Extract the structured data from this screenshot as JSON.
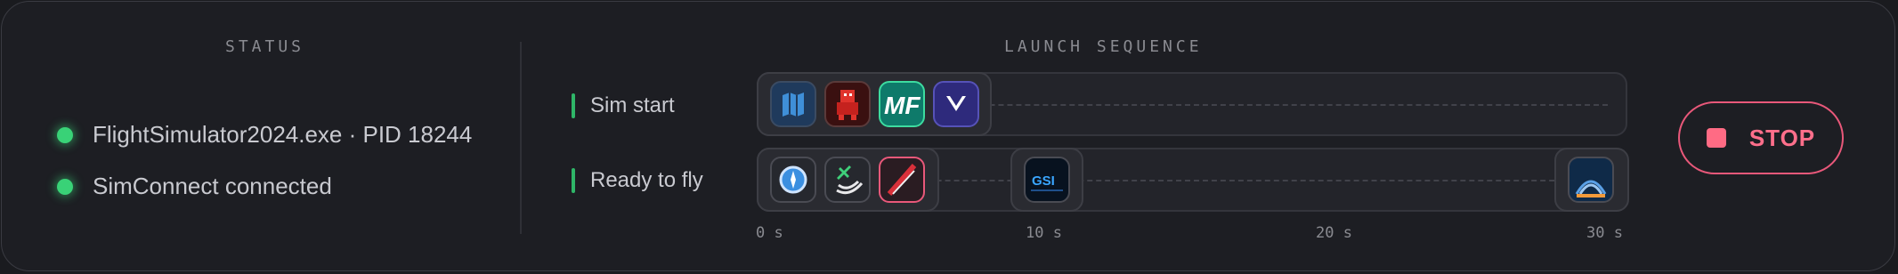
{
  "status": {
    "title": "STATUS",
    "items": [
      {
        "label": "FlightSimulator2024.exe · PID 18244",
        "state": "ok"
      },
      {
        "label": "SimConnect connected",
        "state": "ok"
      }
    ]
  },
  "launch": {
    "title": "LAUNCH SEQUENCE",
    "rows": [
      {
        "label": "Sim start",
        "icons": [
          "map-app-icon",
          "red-robot-app-icon",
          "mf-app-icon",
          "v-check-app-icon"
        ]
      },
      {
        "label": "Ready to fly",
        "icons": [
          "compass-app-icon",
          "radar-plane-app-icon",
          "red-slash-app-icon",
          "gsi-app-icon",
          "orange-waves-app-icon"
        ]
      }
    ],
    "ticks": [
      "0 s",
      "10 s",
      "20 s",
      "30 s"
    ]
  },
  "stop": {
    "label": "STOP"
  },
  "colors": {
    "ok": "#39d277",
    "accent": "#2fb668",
    "stop": "#ff6b84"
  }
}
